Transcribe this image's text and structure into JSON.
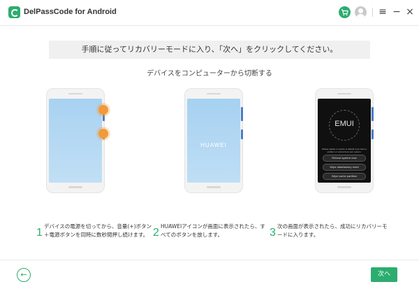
{
  "app": {
    "title": "DelPassCode for Android",
    "icon": "app-logo-icon",
    "accent_color": "#2cad6f"
  },
  "window_controls": {
    "cart_icon": "cart-icon",
    "account_icon": "account-icon",
    "menu_glyph": "≡",
    "minimize_glyph": "−",
    "close_glyph": "×"
  },
  "instruction": {
    "banner": "手順に従ってリカバリーモードに入り、「次へ」をクリックしてください。",
    "subheading": "デバイスをコンピューターから切断する"
  },
  "phones": {
    "phone2_brand": "HUAWEI",
    "phone3_logo": "EMUI",
    "phone3_desc": "Please update or restore to default if you have a problem or cannot boot your system.",
    "recovery_options": [
      "Reboot system now",
      "Wipe data/factory reset",
      "Wipe cache partition"
    ]
  },
  "steps": [
    {
      "number": "1",
      "text": "デバイスの電源を切ってから、音量(+)ボタン＋電源ボタンを同時に数秒間押し続けます。"
    },
    {
      "number": "2",
      "text": "HUAWEIアイコンが画面に表示されたら、すべてのボタンを放します。"
    },
    {
      "number": "3",
      "text": "次の画面が表示されたら、成功にリカバリーモードに入ります。"
    }
  ],
  "footer": {
    "back_glyph": "←",
    "next_label": "次へ"
  }
}
